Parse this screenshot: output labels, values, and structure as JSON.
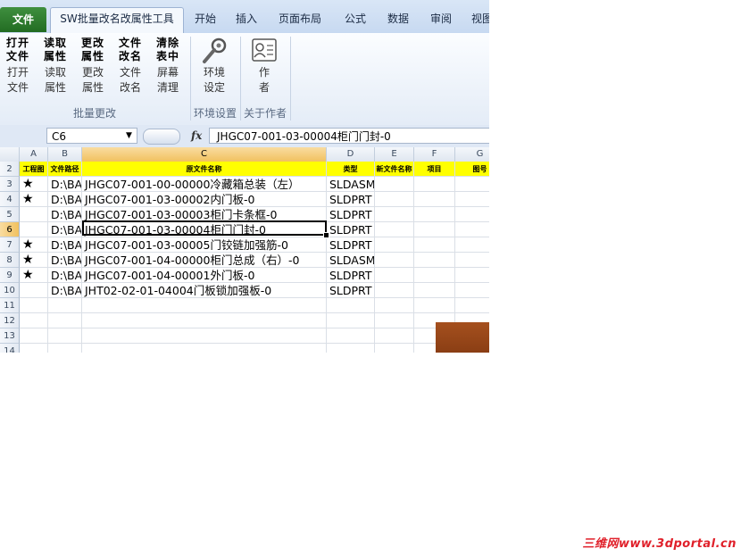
{
  "tabs": {
    "file": "文件",
    "active": "SW批量改名改属性工具",
    "others": [
      "开始",
      "插入",
      "页面布局",
      "公式",
      "数据",
      "审阅",
      "视图"
    ]
  },
  "ribbon": {
    "buttons": [
      {
        "glyph": "打开 文件",
        "label_l1": "打开",
        "label_l2": "文件"
      },
      {
        "glyph": "读取 属性",
        "label_l1": "读取",
        "label_l2": "属性"
      },
      {
        "glyph": "更改 属性",
        "label_l1": "更改",
        "label_l2": "属性"
      },
      {
        "glyph": "文件 改名",
        "label_l1": "文件",
        "label_l2": "改名"
      },
      {
        "glyph": "清除 表中",
        "label_l1": "屏幕",
        "label_l2": "清理"
      }
    ],
    "env_button": {
      "label_l1": "环境",
      "label_l2": "设定",
      "icon": "wrench-gear-icon"
    },
    "author_button": {
      "label_l1": "作",
      "label_l2": "者",
      "icon": "contact-card-icon"
    },
    "groups": [
      "批量更改",
      "环境设置",
      "关于作者"
    ]
  },
  "formula_bar": {
    "name_box": "C6",
    "fx": "fx",
    "formula": "JHGC07-001-03-00004柜门门封-0"
  },
  "grid": {
    "columns": [
      "A",
      "B",
      "C",
      "D",
      "E",
      "F",
      "G"
    ],
    "selected_column": "C",
    "selected_row": "6",
    "header_row": {
      "row": "2",
      "cells": [
        "工程图",
        "文件路径",
        "原文件名称",
        "类型",
        "新文件名称",
        "项目",
        "图号"
      ]
    },
    "rows": [
      {
        "row": "3",
        "star": "★",
        "path": "D:\\BA",
        "name": "JHGC07-001-00-00000冷藏箱总装（左）",
        "type": "SLDASM"
      },
      {
        "row": "4",
        "star": "★",
        "path": "D:\\BA",
        "name": "JHGC07-001-03-00002内门板-0",
        "type": "SLDPRT"
      },
      {
        "row": "5",
        "star": "",
        "path": "D:\\BA",
        "name": "JHGC07-001-03-00003柜门卡条框-0",
        "type": "SLDPRT"
      },
      {
        "row": "6",
        "star": "",
        "path": "D:\\BA",
        "name": "JHGC07-001-03-00004柜门门封-0",
        "type": "SLDPRT"
      },
      {
        "row": "7",
        "star": "★",
        "path": "D:\\BA",
        "name": "JHGC07-001-03-00005门铰链加强筋-0",
        "type": "SLDPRT"
      },
      {
        "row": "8",
        "star": "★",
        "path": "D:\\BA",
        "name": "JHGC07-001-04-00000柜门总成（右）-0",
        "type": "SLDASM"
      },
      {
        "row": "9",
        "star": "★",
        "path": "D:\\BA",
        "name": "JHGC07-001-04-00001外门板-0",
        "type": "SLDPRT"
      },
      {
        "row": "10",
        "star": "",
        "path": "D:\\BA",
        "name": "JHT02-02-01-04004门板锁加强板-0",
        "type": "SLDPRT"
      }
    ],
    "empty_rows": [
      "11",
      "12",
      "13",
      "14"
    ]
  },
  "watermark": "三维网www.3dportal.cn",
  "colors": {
    "header_fill": "#ffff00",
    "selection": "#f1c15f",
    "file_tab": "#2f7d2f",
    "watermark": "#e0202a"
  }
}
